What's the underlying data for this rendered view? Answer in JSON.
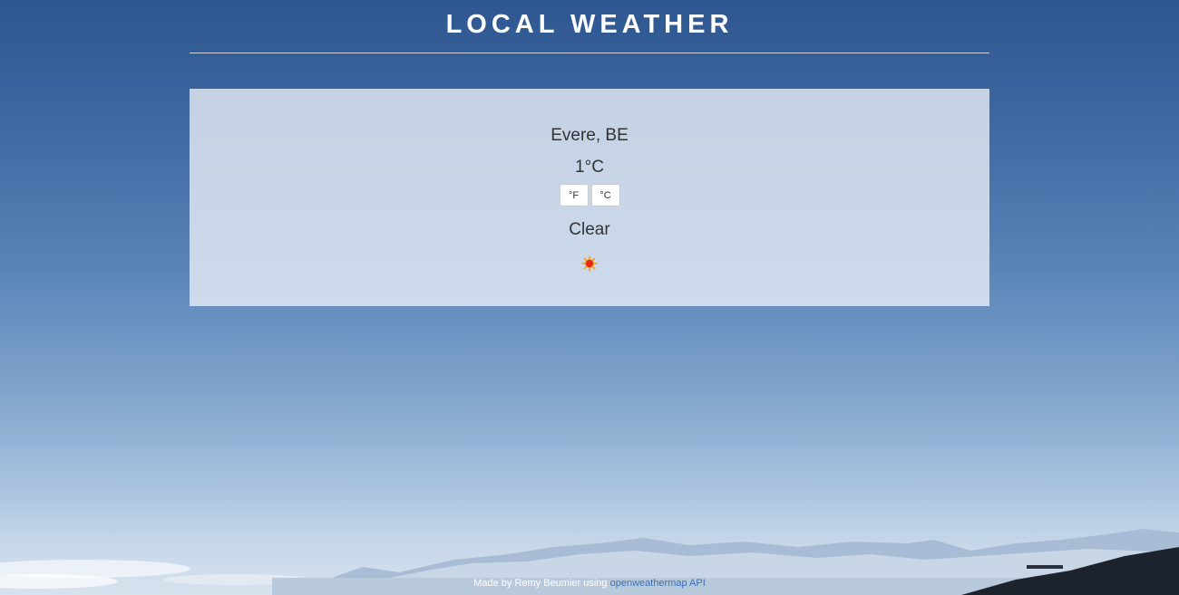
{
  "header": {
    "title": "LOCAL WEATHER"
  },
  "weather": {
    "location": "Evere, BE",
    "temperature": "1°C",
    "unit_buttons": {
      "fahrenheit_label": "°F",
      "celsius_label": "°C"
    },
    "condition": "Clear",
    "icon": "sun-icon"
  },
  "footer": {
    "prefix": "Made by Remy Beumier using ",
    "link_text": "openweathermap API"
  },
  "colors": {
    "sky_top": "#2e5690",
    "sky_bottom": "#d7e2ee",
    "card_background": "#ecf1f8",
    "text": "#333333",
    "link": "#3a6fb5",
    "sun": "#e8261c"
  }
}
